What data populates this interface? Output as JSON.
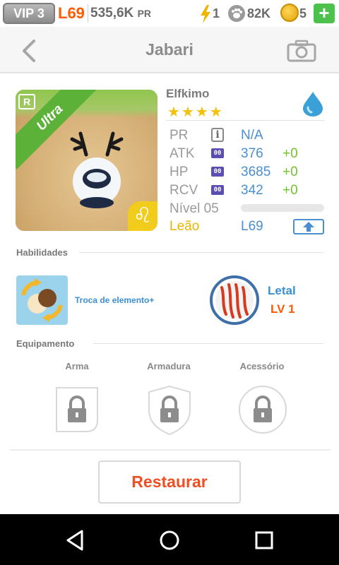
{
  "status_bar": {
    "vip": "VIP 3",
    "level": "L69",
    "power": "535,6K",
    "power_unit": "PR",
    "energy": "1",
    "paws": "82K",
    "coins": "5",
    "add_label": "+"
  },
  "header": {
    "title": "Jabari"
  },
  "pet": {
    "name": "Elfkimo",
    "rarity": "Ultra",
    "rarity_badge": "R",
    "stars": "★★★★",
    "star_count": 4,
    "element_icon": "water-drop-icon",
    "stats": [
      {
        "label": "PR",
        "value": "N/A",
        "bonus": ""
      },
      {
        "label": "ATK",
        "value": "376",
        "bonus": "+0"
      },
      {
        "label": "HP",
        "value": "3685",
        "bonus": "+0"
      },
      {
        "label": "RCV",
        "value": "342",
        "bonus": "+0"
      }
    ],
    "level_label": "Nível 05",
    "level_progress": 0.0,
    "sign_name": "Leão",
    "sign_symbol": "♌",
    "sign_level": "L69"
  },
  "skills": {
    "title": "Habilidades",
    "skill1_label": "Troca de elemento+",
    "skill2_name": "Letal",
    "skill2_level": "LV 1"
  },
  "equipment": {
    "title": "Equipamento",
    "slots": [
      "Arma",
      "Armadura",
      "Acessório"
    ]
  },
  "actions": {
    "restore": "Restaurar"
  },
  "colors": {
    "accent_blue": "#4a8fd1",
    "accent_orange": "#ff5a00",
    "bonus_green": "#72c22a",
    "star_yellow": "#f2c10c",
    "restore_red": "#ee4f24"
  }
}
